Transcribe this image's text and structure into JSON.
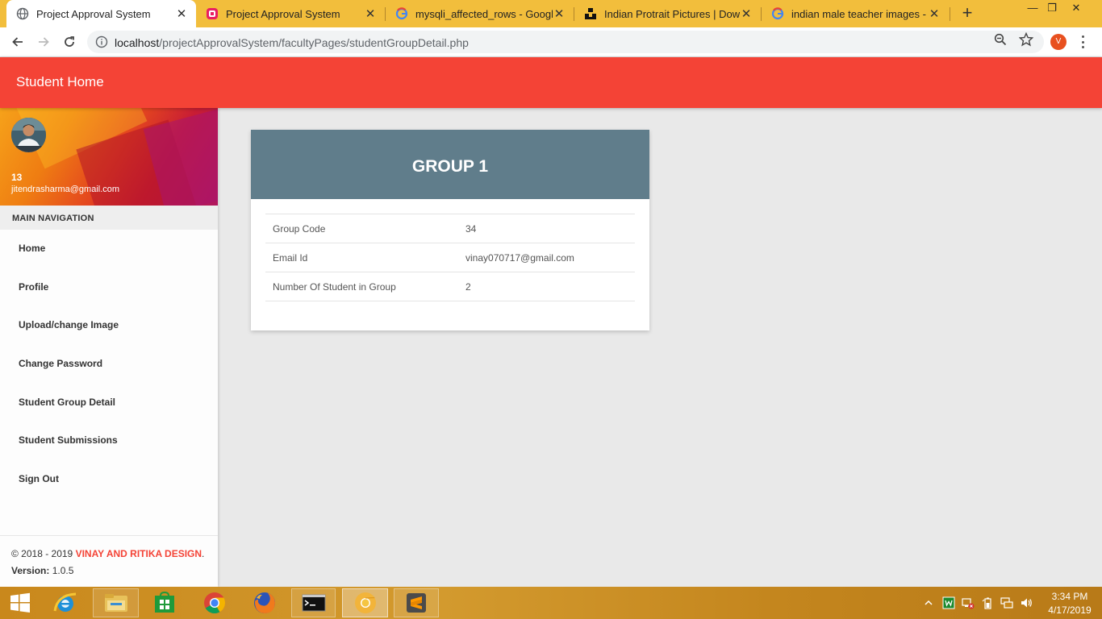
{
  "browser": {
    "tabs": [
      {
        "title": "Project Approval System",
        "icon": "globe-icon"
      },
      {
        "title": "Project Approval System",
        "icon": "app-logo-icon"
      },
      {
        "title": "mysqli_affected_rows - Google S",
        "icon": "google-icon"
      },
      {
        "title": "Indian Protrait Pictures | Downlo",
        "icon": "unsplash-icon"
      },
      {
        "title": "indian male teacher images - Go",
        "icon": "google-icon"
      }
    ],
    "url_host": "localhost",
    "url_path": "/projectApprovalSystem/facultyPages/studentGroupDetail.php",
    "profile_initial": "V",
    "accent_color": "#f2be3c"
  },
  "app": {
    "title": "Student Home",
    "header_color": "#f44336"
  },
  "sidebar": {
    "user_name": "13",
    "user_email": "jitendrasharma@gmail.com",
    "nav_header": "MAIN NAVIGATION",
    "items": [
      {
        "label": "Home"
      },
      {
        "label": "Profile"
      },
      {
        "label": "Upload/change Image"
      },
      {
        "label": "Change Password"
      },
      {
        "label": "Student Group Detail"
      },
      {
        "label": "Student Submissions"
      },
      {
        "label": "Sign Out"
      }
    ],
    "footer": {
      "copyright_prefix": "© 2018 - 2019 ",
      "brand": "VINAY AND RITIKA DESIGN",
      "copyright_suffix": ".",
      "version_label": "Version:",
      "version_value": " 1.0.5"
    }
  },
  "group_card": {
    "title": "GROUP 1",
    "header_color": "#607d8b",
    "rows": [
      {
        "label": "Group Code",
        "value": "34"
      },
      {
        "label": "Email Id",
        "value": "vinay070717@gmail.com"
      },
      {
        "label": "Number Of Student in Group",
        "value": "2"
      }
    ]
  },
  "taskbar": {
    "time": "3:34 PM",
    "date": "4/17/2019"
  }
}
